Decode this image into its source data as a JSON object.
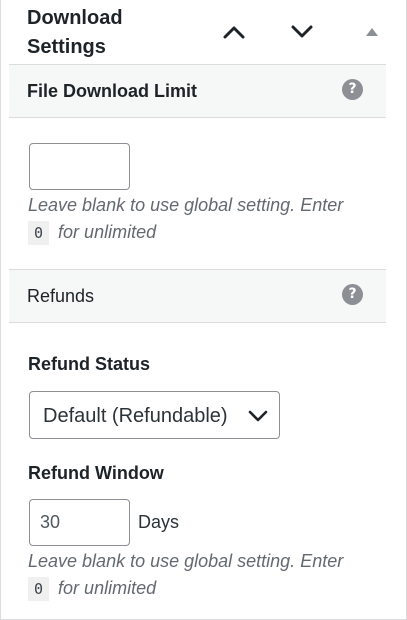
{
  "header": {
    "title": "Download Settings",
    "move_up_label": "Move up",
    "move_down_label": "Move down",
    "toggle_label": "Toggle panel"
  },
  "file_download": {
    "section_label": "File Download Limit",
    "limit_value": "",
    "help_before": "Leave blank to use global setting. Enter",
    "help_code": "0",
    "help_after": "for unlimited"
  },
  "refunds": {
    "section_label": "Refunds",
    "status_label": "Refund Status",
    "status_selected": "Default (Refundable)",
    "window_label": "Refund Window",
    "window_value": "30",
    "window_unit": "Days",
    "help_before": "Leave blank to use global setting. Enter",
    "help_code": "0",
    "help_after": "for unlimited"
  },
  "colors": {
    "text": "#1d2327",
    "help_text": "#646970",
    "section_bg": "#f6f7f7",
    "border": "#dcdcde",
    "help_icon": "#8c8f94"
  },
  "icons": {
    "move_up": "chevron-up-icon",
    "move_down": "chevron-down-icon",
    "toggle": "triangle-up-icon",
    "help": "question-circle-icon"
  }
}
